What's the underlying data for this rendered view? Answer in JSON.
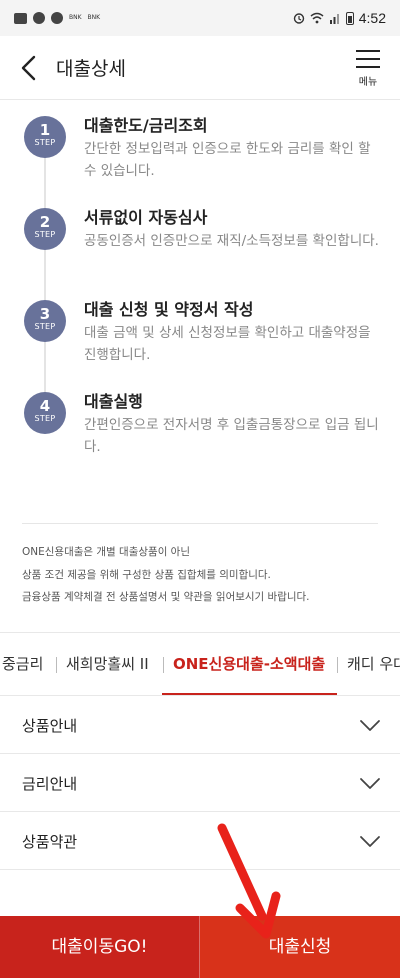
{
  "status_bar": {
    "time": "4:52",
    "mini_labels": [
      "BNK",
      "BNK"
    ]
  },
  "header": {
    "title": "대출상세",
    "menu_label": "메뉴"
  },
  "steps": [
    {
      "number": "1",
      "step_word": "STEP",
      "title": "대출한도/금리조회",
      "desc": "간단한 정보입력과 인증으로 한도와 금리를 확인 할 수 있습니다."
    },
    {
      "number": "2",
      "step_word": "STEP",
      "title": "서류없이 자동심사",
      "desc": "공동인증서 인증만으로 재직/소득정보를 확인합니다."
    },
    {
      "number": "3",
      "step_word": "STEP",
      "title": "대출 신청 및 약정서 작성",
      "desc": "대출 금액 및 상세 신청정보를 확인하고 대출약정을 진행합니다."
    },
    {
      "number": "4",
      "step_word": "STEP",
      "title": "대출실행",
      "desc": "간편인증으로 전자서명 후 입출금통장으로 입금 됩니다."
    }
  ],
  "notice": {
    "lines": [
      "ONE신용대출은 개별 대출상품이 아닌",
      "상품 조건 제공을 위해 구성한 상품 집합체를 의미합니다.",
      "금융상품 계약체결 전 상품설명서 및 약관을 읽어보시기 바랍니다."
    ]
  },
  "tabs": [
    {
      "label": "중금리",
      "active": false
    },
    {
      "label": "새희망홀씨 II",
      "active": false
    },
    {
      "label": "ONE신용대출-소액대출",
      "active": true
    },
    {
      "label": "캐디 우대",
      "active": false
    }
  ],
  "accordion": [
    {
      "label": "상품안내"
    },
    {
      "label": "금리안내"
    },
    {
      "label": "상품약관"
    }
  ],
  "bottom_buttons": {
    "left": "대출이동GO!",
    "right": "대출신청"
  },
  "colors": {
    "brand_red": "#c8231c",
    "step_circle": "#68729a",
    "annotation_arrow": "#e8221a"
  }
}
